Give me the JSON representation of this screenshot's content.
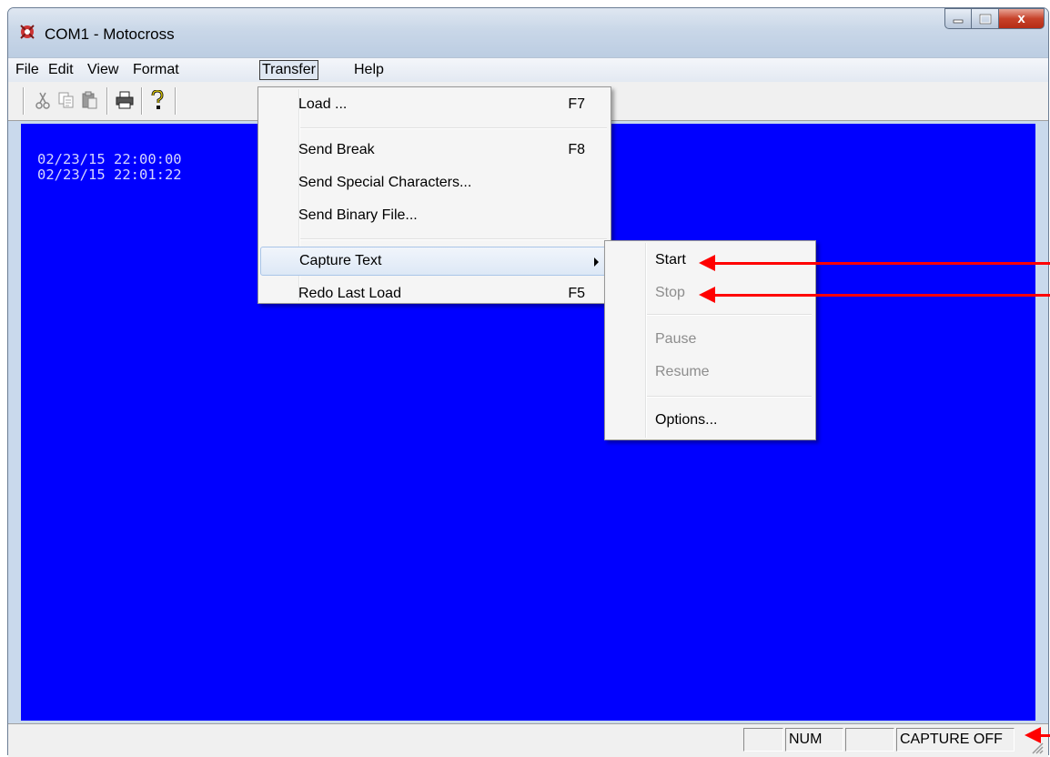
{
  "window": {
    "title": "COM1 - Motocross",
    "close_label": "x"
  },
  "menubar": {
    "items": [
      "File",
      "Edit",
      "View",
      "Format",
      "Transfer",
      "Help"
    ],
    "active": "Transfer"
  },
  "toolbar": {
    "icons": [
      "cut-icon",
      "copy-icon",
      "paste-icon",
      "print-icon",
      "help-icon"
    ]
  },
  "terminal": {
    "lines": [
      "02/23/15 22:00:00 ",
      "02/23/15 22:01:22 "
    ],
    "background": "#0000ff"
  },
  "transfer_menu": {
    "load": {
      "label": "Load ...",
      "shortcut": "F7"
    },
    "send_break": {
      "label": "Send Break",
      "shortcut": "F8"
    },
    "send_special": {
      "label": "Send Special Characters..."
    },
    "send_binary": {
      "label": "Send Binary File..."
    },
    "capture_text": {
      "label": "Capture Text"
    },
    "redo_last_load": {
      "label": "Redo Last Load",
      "shortcut": "F5"
    }
  },
  "capture_submenu": {
    "start": "Start",
    "stop": "Stop",
    "pause": "Pause",
    "resume": "Resume",
    "options": "Options..."
  },
  "statusbar": {
    "num": "NUM",
    "capture": "CAPTURE OFF"
  },
  "annotation_color": "#ff0000"
}
